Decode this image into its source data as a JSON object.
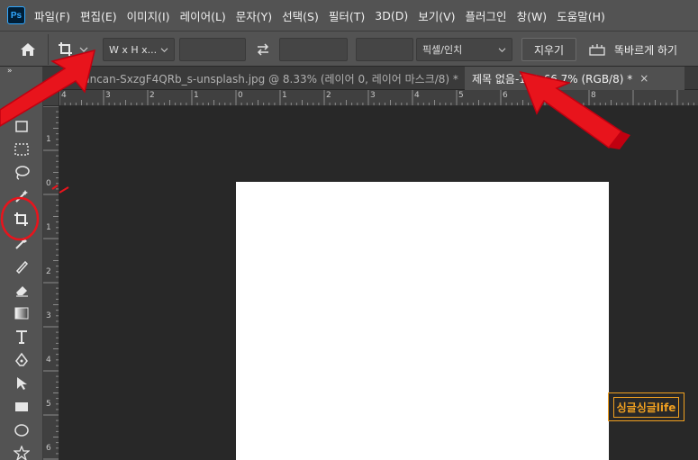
{
  "app": {
    "logo_text": "Ps"
  },
  "menu": {
    "items": [
      "파일(F)",
      "편집(E)",
      "이미지(I)",
      "레이어(L)",
      "문자(Y)",
      "선택(S)",
      "필터(T)",
      "3D(D)",
      "보기(V)",
      "플러그인",
      "창(W)",
      "도움말(H)"
    ]
  },
  "options": {
    "ratio_value": "W x H x...",
    "width_value": "",
    "height_value": "",
    "resolution_value": "",
    "units_value": "픽셀/인치",
    "clear_label": "지우기",
    "straighten_label": "똑바르게 하기"
  },
  "toolbar": {
    "collapse_glyph": "»"
  },
  "tabs": [
    {
      "label": "uncan-SxzgF4QRb_s-unsplash.jpg @ 8.33% (레이어 0, 레이어 마스크/8) *",
      "close": "×",
      "active": false
    },
    {
      "label": "제목 없음-1 @ 66.7% (RGB/8) *",
      "close": "×",
      "active": true
    }
  ],
  "rulers": {
    "top_labels": [
      "4",
      "3",
      "2",
      "1",
      "0",
      "1",
      "2",
      "3",
      "4",
      "5",
      "6",
      "7",
      "8"
    ],
    "left_labels": [
      "1",
      "0",
      "1",
      "2",
      "3",
      "4",
      "5",
      "6"
    ]
  },
  "watermark": {
    "text": "싱글싱글life"
  },
  "colors": {
    "chrome": "#535353",
    "canvas_bg": "#282828",
    "annotation_red": "#e8141c",
    "watermark": "#f0a020"
  }
}
